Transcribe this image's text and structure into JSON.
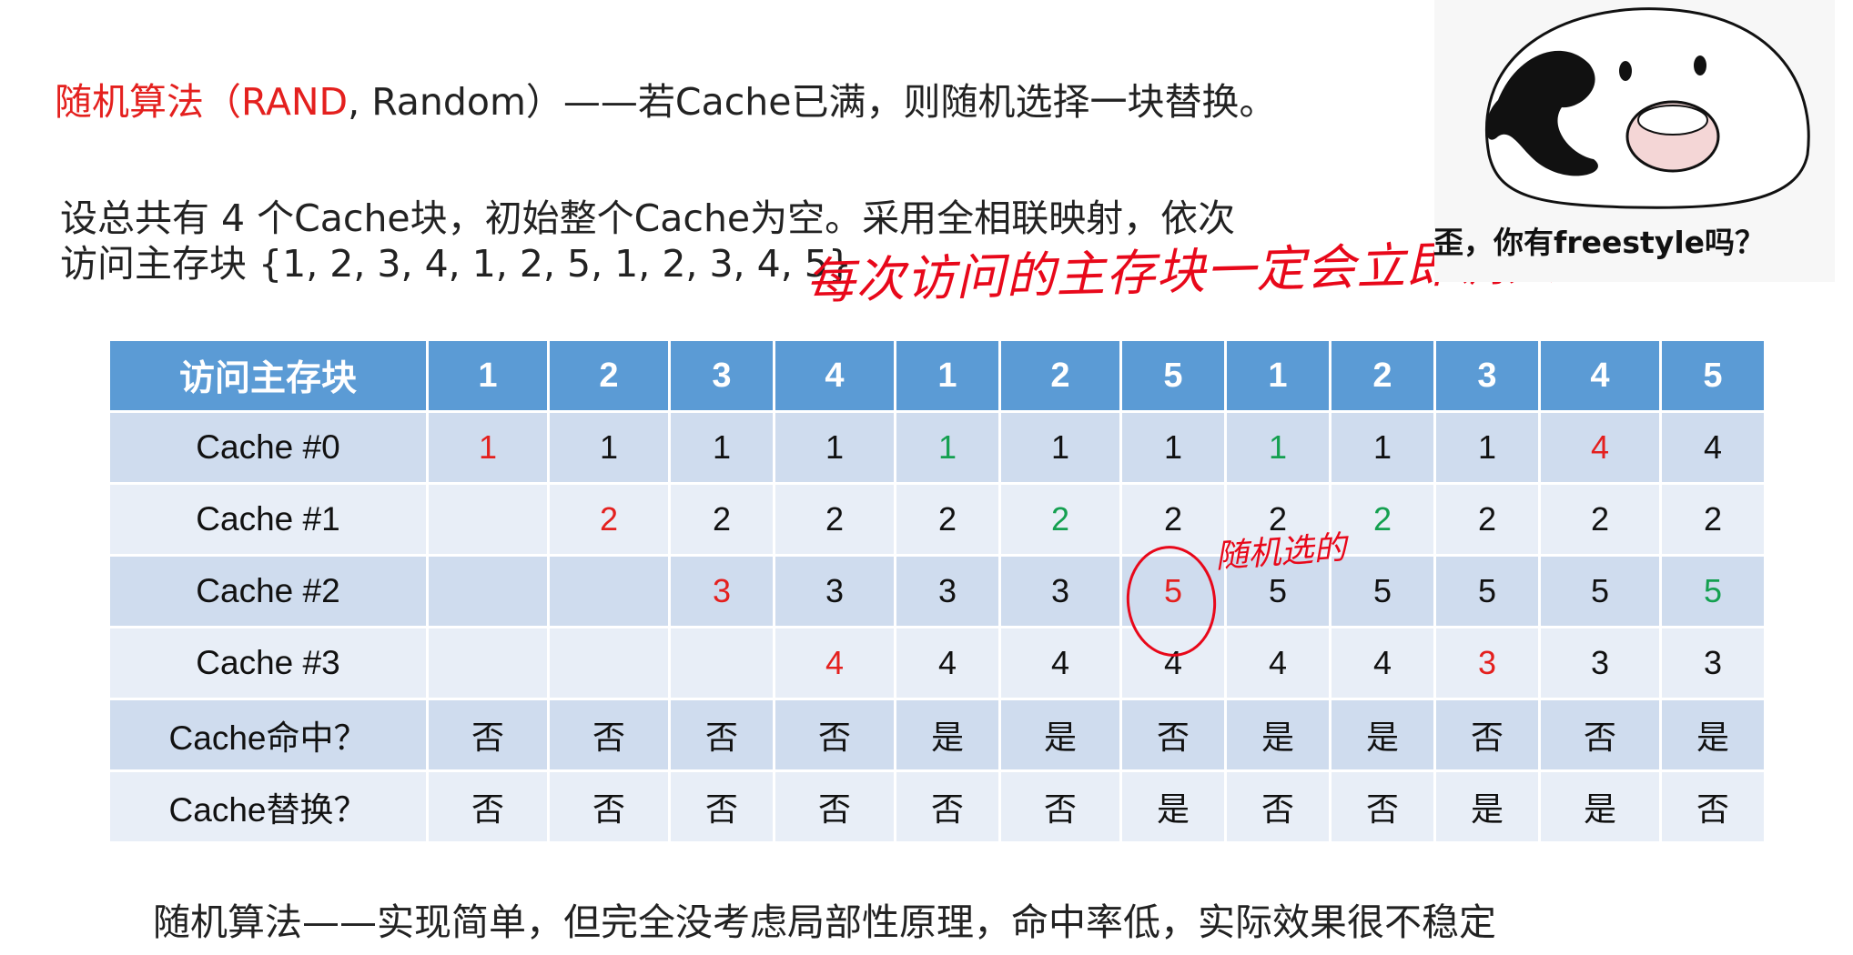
{
  "title": {
    "red_part": "随机算法（RAND",
    "black_part": ", Random）——若Cache已满，则随机选择一块替换。"
  },
  "description": {
    "line1": "设总共有 4 个Cache块，初始整个Cache为空。采用全相联映射，依次",
    "line2": "访问主存块 {1, 2, 3, 4, 1, 2, 5, 1, 2, 3, 4, 5}"
  },
  "handwritten": {
    "top_note": "每次访问的主存块一定会立即调入Cache",
    "side_note": "随机选的"
  },
  "meme": {
    "caption": "歪，你有freestyle吗？"
  },
  "table": {
    "header_label": "访问主存块",
    "accesses": [
      "1",
      "2",
      "3",
      "4",
      "1",
      "2",
      "5",
      "1",
      "2",
      "3",
      "4",
      "5"
    ],
    "rows": [
      {
        "label": "Cache #0",
        "cells": [
          "1",
          "1",
          "1",
          "1",
          "1",
          "1",
          "1",
          "1",
          "1",
          "1",
          "4",
          "4"
        ]
      },
      {
        "label": "Cache #1",
        "cells": [
          "",
          "2",
          "2",
          "2",
          "2",
          "2",
          "2",
          "2",
          "2",
          "2",
          "2",
          "2"
        ]
      },
      {
        "label": "Cache #2",
        "cells": [
          "",
          "",
          "3",
          "3",
          "3",
          "3",
          "5",
          "5",
          "5",
          "5",
          "5",
          "5"
        ]
      },
      {
        "label": "Cache #3",
        "cells": [
          "",
          "",
          "",
          "4",
          "4",
          "4",
          "4",
          "4",
          "4",
          "3",
          "3",
          "3"
        ]
      },
      {
        "label": "Cache命中？",
        "cells": [
          "否",
          "否",
          "否",
          "否",
          "是",
          "是",
          "否",
          "是",
          "是",
          "否",
          "否",
          "是"
        ]
      },
      {
        "label": "Cache替换？",
        "cells": [
          "否",
          "否",
          "否",
          "否",
          "否",
          "否",
          "是",
          "否",
          "否",
          "是",
          "是",
          "否"
        ]
      }
    ],
    "colors": {
      "red": "#e4201e",
      "green": "#14a050",
      "header_bg": "#5b9bd5"
    }
  },
  "summary": "随机算法——实现简单，但完全没考虑局部性原理，命中率低，实际效果很不稳定"
}
